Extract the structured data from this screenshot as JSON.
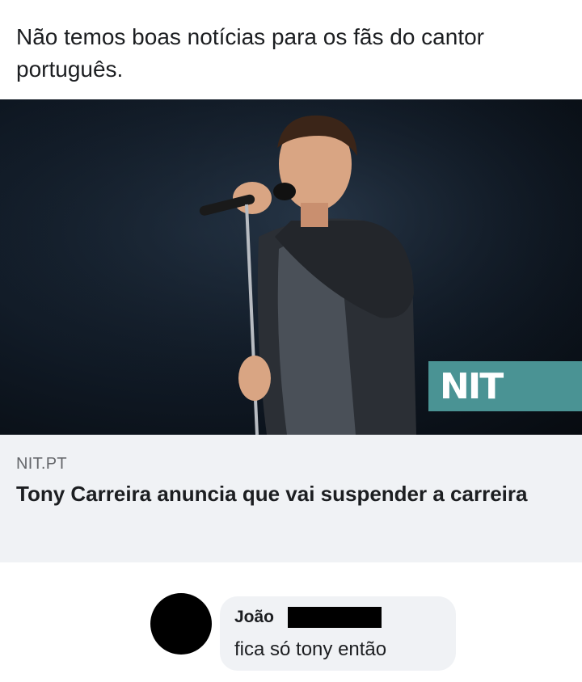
{
  "post": {
    "text": "Não temos boas notícias para os fãs do cantor português."
  },
  "link_preview": {
    "image_description": "Singer performing on stage holding a microphone stand",
    "watermark": "NIT",
    "domain": "NIT.PT",
    "title": "Tony Carreira anuncia que vai suspender a carreira"
  },
  "comment": {
    "author": "João",
    "text": "fica só tony então"
  },
  "colors": {
    "text": "#1c1e21",
    "muted": "#65676b",
    "panel": "#f0f2f5",
    "watermark_bg": "#4a9394"
  }
}
